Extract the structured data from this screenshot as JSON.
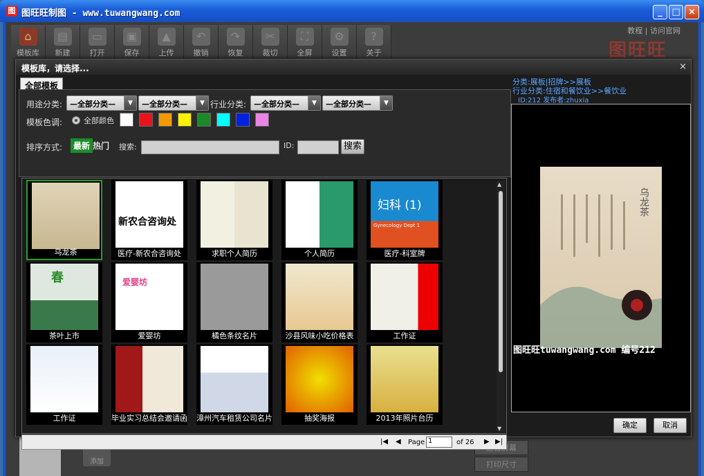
{
  "window": {
    "title": "图旺旺制图 - www.tuwangwang.com",
    "app_icon_glyph": "图"
  },
  "toolbar": {
    "items": [
      {
        "label": "模板库",
        "icon": "house-icon"
      },
      {
        "label": "新建",
        "icon": "new-file-icon"
      },
      {
        "label": "打开",
        "icon": "folder-icon"
      },
      {
        "label": "保存",
        "icon": "save-icon"
      },
      {
        "label": "上传",
        "icon": "upload-icon"
      },
      {
        "label": "撤销",
        "icon": "undo-icon"
      },
      {
        "label": "恢复",
        "icon": "redo-icon"
      },
      {
        "label": "裁切",
        "icon": "scissors-icon"
      },
      {
        "label": "全屏",
        "icon": "fullscreen-icon"
      },
      {
        "label": "设置",
        "icon": "gear-icon"
      },
      {
        "label": "关于",
        "icon": "help-icon"
      }
    ],
    "links": {
      "tutorial": "教程",
      "sep": "|",
      "website": "访问官网"
    },
    "brand": "图旺旺"
  },
  "bottom": {
    "fit_screen": "适合屏幕",
    "print_size": "打印尺寸",
    "add": "添加"
  },
  "modal": {
    "title": "模板库，请选择...",
    "close": "×",
    "tab": "全部模板",
    "filters": {
      "usage_label": "用途分类:",
      "usage_select_1": "—全部分类—",
      "usage_select_2": "—全部分类—",
      "industry_label": "行业分类:",
      "industry_select_1": "—全部分类—",
      "industry_select_2": "—全部分类—",
      "color_label": "模板色调:",
      "all_colors": "全部颜色",
      "colors": [
        "#ffffff",
        "#e8141a",
        "#f39800",
        "#fff100",
        "#1c8a27",
        "#00ffff",
        "#0021e0",
        "#ea84e6"
      ],
      "sort_label": "排序方式:",
      "sort_new": "最新",
      "sort_hot": "热门",
      "search_label": "搜索:",
      "id_label": "ID:",
      "search_button": "搜索",
      "search_value": "",
      "id_value": ""
    },
    "templates": [
      {
        "caption": "乌龙茶",
        "selected": true
      },
      {
        "caption": "医疗-新农合咨询处"
      },
      {
        "caption": "求职个人简历"
      },
      {
        "caption": "个人简历"
      },
      {
        "caption": "医疗-科室牌"
      },
      {
        "caption": "茶叶上市"
      },
      {
        "caption": "爱婴坊"
      },
      {
        "caption": "橘色条纹名片"
      },
      {
        "caption": "沙县风味小吃价格表"
      },
      {
        "caption": "工作证"
      },
      {
        "caption": "工作证"
      },
      {
        "caption": "毕业实习总结会邀请函"
      },
      {
        "caption": "漳州汽车租赁公司名片"
      },
      {
        "caption": "抽奖海报"
      },
      {
        "caption": "2013年照片台历"
      }
    ],
    "thumb_text": {
      "t1": "新农合咨询处",
      "t4": "妇科 (1)",
      "t4_sub": "Gynecology Dept 1",
      "t5": "春",
      "t6": "爱婴坊"
    },
    "pager": {
      "page_label": "Page",
      "page_value": "1",
      "of_label": "of 26"
    },
    "right": {
      "category": "分类:展板|招牌>>展板",
      "industry": "行业分类:住宿和餐饮业>>餐饮业",
      "id_publisher": "ID:212  发布者:zhuxia",
      "preview_title": "乌龙茶",
      "preview_footer": "图旺旺tuwangwang.com 编号212",
      "ok_button": "确定",
      "cancel_button": "取消"
    }
  }
}
